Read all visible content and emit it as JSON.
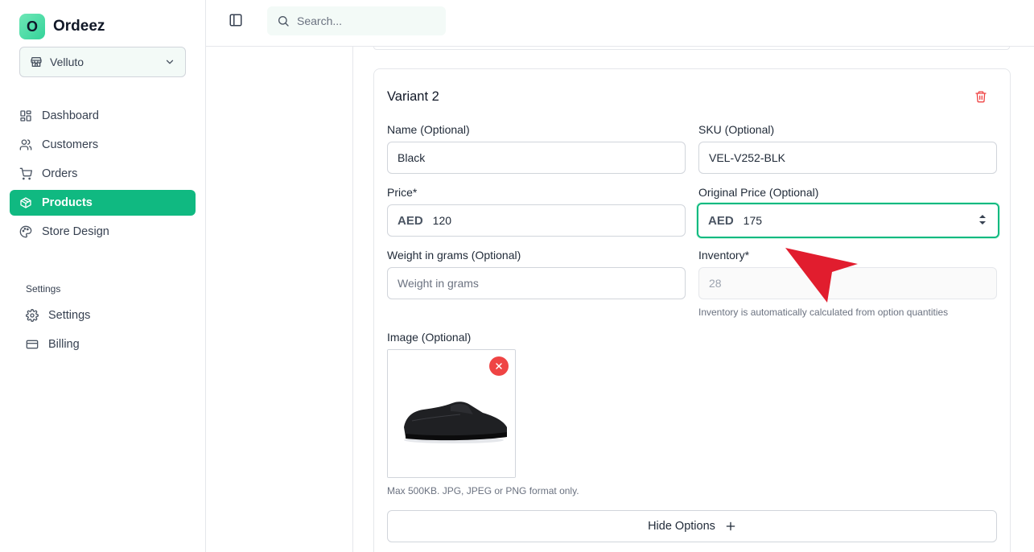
{
  "brand": {
    "logo_letter": "O",
    "name": "Ordeez"
  },
  "store_selector": {
    "value": "Velluto"
  },
  "nav": {
    "items": [
      {
        "label": "Dashboard",
        "icon": "layout-grid-icon"
      },
      {
        "label": "Customers",
        "icon": "users-icon"
      },
      {
        "label": "Orders",
        "icon": "cart-icon"
      },
      {
        "label": "Products",
        "icon": "box-icon",
        "active": true
      },
      {
        "label": "Store Design",
        "icon": "palette-icon"
      }
    ],
    "settings_section_label": "Settings",
    "settings_items": [
      {
        "label": "Settings",
        "icon": "gear-icon"
      },
      {
        "label": "Billing",
        "icon": "credit-card-icon"
      }
    ]
  },
  "topbar": {
    "search_placeholder": "Search..."
  },
  "variant": {
    "title": "Variant 2",
    "name_label": "Name (Optional)",
    "name_value": "Black",
    "sku_label": "SKU (Optional)",
    "sku_value": "VEL-V252-BLK",
    "price_label": "Price*",
    "price_currency": "AED",
    "price_value": "120",
    "original_price_label": "Original Price (Optional)",
    "original_price_currency": "AED",
    "original_price_value": "175",
    "weight_label": "Weight in grams (Optional)",
    "weight_placeholder": "Weight in grams",
    "inventory_label": "Inventory*",
    "inventory_value": "28",
    "inventory_helper": "Inventory is automatically calculated from option quantities",
    "image_label": "Image (Optional)",
    "image_helper": "Max 500KB. JPG, JPEG or PNG format only.",
    "hide_options_label": "Hide Options"
  },
  "colors": {
    "accent": "#10b981",
    "danger": "#ef4444",
    "pointer": "#e11d2e"
  }
}
